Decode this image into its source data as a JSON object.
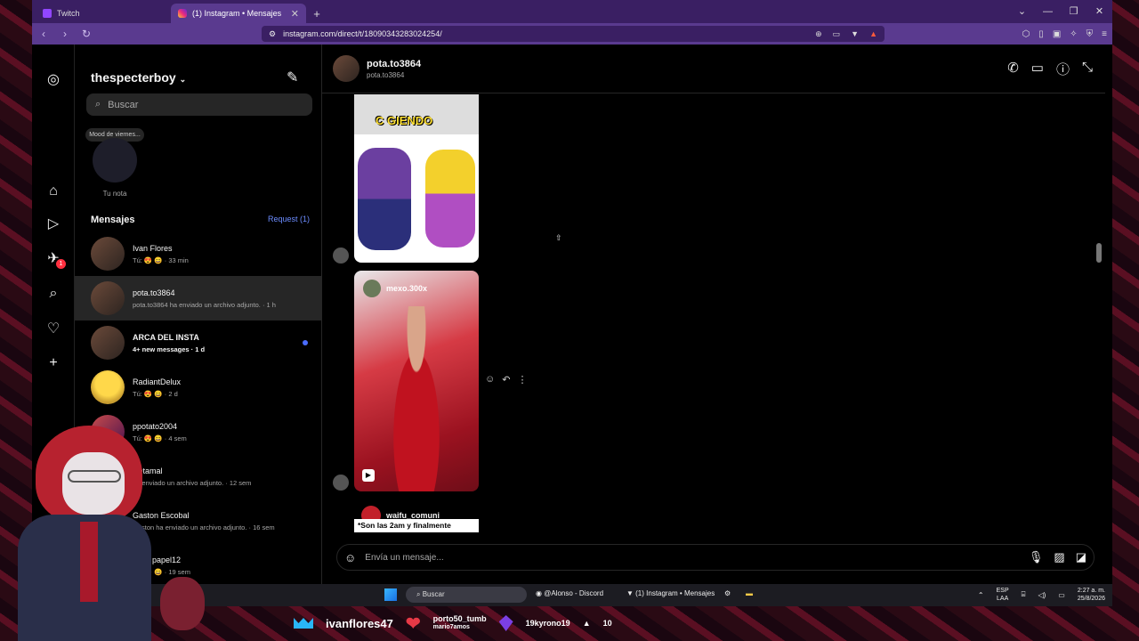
{
  "browser": {
    "tabs": [
      {
        "label": "Twitch"
      },
      {
        "label": "(1) Instagram • Mensajes"
      }
    ],
    "new_tab": "+",
    "url": "instagram.com/direct/t/18090343283024254/"
  },
  "inbox": {
    "username": "thespecterboy",
    "search_placeholder": "Buscar",
    "note_text": "Mood de viernes...",
    "note_caption": "Tu nota",
    "messages_label": "Mensajes",
    "requests_label": "Request (1)",
    "conversations": [
      {
        "name": "Ivan Flores",
        "preview": "Tú: 😍 😄 · 33 min"
      },
      {
        "name": "pota.to3864",
        "preview": "pota.to3864 ha enviado un archivo adjunto. · 1 h"
      },
      {
        "name": "ARCA DEL INSTA",
        "preview": "4+ new messages · 1 d"
      },
      {
        "name": "RadiantDelux",
        "preview": "Tú: 😍 😄 · 2 d"
      },
      {
        "name": "ppotato2004",
        "preview": "Tú: 😍 😄 · 4 sem"
      },
      {
        "name": "Retamal",
        "preview": "ha enviado un archivo adjunto. · 12 sem"
      },
      {
        "name": "Gaston Escobal",
        "preview": "Gaston ha enviado un archivo adjunto. · 16 sem"
      },
      {
        "name": "tinad papel12",
        "preview": "Tú: 😍 😄 · 19 sem"
      }
    ],
    "rail_badge": "1"
  },
  "chat": {
    "name": "pota.to3864",
    "handle": "pota.to3864",
    "media1_caption": "C GIENDO",
    "media2_user": "mexo.300x",
    "media3_user": "waifu_comuni",
    "media3_text": "*Son las 2am y finalmente",
    "composer_placeholder": "Envía un mensaje..."
  },
  "taskbar": {
    "search": "Buscar",
    "apps": [
      "@Alonso - Discord",
      "(1) Instagram • Mensajes"
    ],
    "lang_top": "ESP",
    "lang_bottom": "LAA",
    "time": "2:27 a. m.",
    "date": "25/8/2026"
  },
  "stream_overlay": {
    "top_user": "ivanflores47",
    "middle_top": "porto50_tumb",
    "middle_bottom": "mario7amos",
    "right_user": "19kyrono19",
    "right_count": "10"
  }
}
